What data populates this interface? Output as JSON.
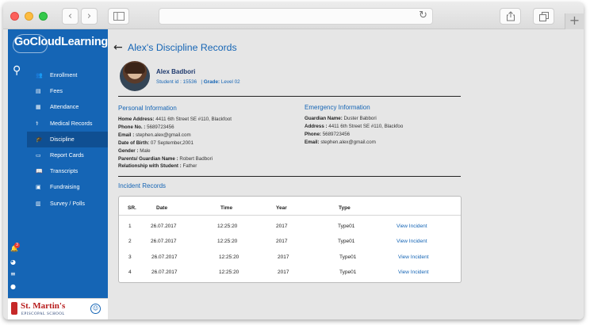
{
  "browser": {
    "back_glyph": "‹",
    "forward_glyph": "›",
    "reload_glyph": "↻"
  },
  "sidebar": {
    "logo": "GoCloudLearning",
    "items": [
      {
        "label": "Enrollment",
        "icon": "users-icon",
        "glyph": "👥"
      },
      {
        "label": "Fees",
        "icon": "fees-icon",
        "glyph": "▤"
      },
      {
        "label": "Attendance",
        "icon": "attendance-icon",
        "glyph": "▦"
      },
      {
        "label": "Medical Records",
        "icon": "stethoscope-icon",
        "glyph": "⚕"
      },
      {
        "label": "Discipline",
        "icon": "graduation-cap-icon",
        "glyph": "🎓"
      },
      {
        "label": "Report Cards",
        "icon": "report-card-icon",
        "glyph": "▭"
      },
      {
        "label": "Transcripts",
        "icon": "book-icon",
        "glyph": "📖"
      },
      {
        "label": "Fundraising",
        "icon": "fundraising-icon",
        "glyph": "▣"
      },
      {
        "label": "Survey / Polls",
        "icon": "survey-icon",
        "glyph": "▥"
      }
    ],
    "notification_count": "3",
    "school_name": "St. Martin's",
    "school_sub": "EPISCOPAL SCHOOL"
  },
  "page": {
    "title": "Alex's Discipline Records"
  },
  "student": {
    "name": "Alex Badbori",
    "id_label": "Student id :",
    "id_value": "15536",
    "grade_label": "Grade:",
    "grade_value": "Level 02"
  },
  "personal": {
    "title": "Personal Information",
    "fields": [
      {
        "label": "Home Address:",
        "value": "4411 6th Street SE #110, Blackfoot"
      },
      {
        "label": "Phone No. :",
        "value": "5689723456"
      },
      {
        "label": "Email :",
        "value": "stephen.alex@gmail.com"
      },
      {
        "label": "Date of Birth:",
        "value": "07 September,2001"
      },
      {
        "label": "Gender :",
        "value": "Male"
      },
      {
        "label": "Parents/ Guardian Name :",
        "value": "Robert Badbori"
      },
      {
        "label": "Relationship with Student :",
        "value": "Father"
      }
    ]
  },
  "emergency": {
    "title": "Emergency Information",
    "fields": [
      {
        "label": "Guardian Name:",
        "value": "Duster Babbori"
      },
      {
        "label": "Address :",
        "value": "4411 6th Street SE #110, Blackfoo"
      },
      {
        "label": "Phone:",
        "value": "5689723456"
      },
      {
        "label": "Email:",
        "value": "stephen.alex@gmail.com"
      }
    ]
  },
  "incidents": {
    "title": "Incident Records",
    "headers": [
      "SR.",
      "Date",
      "Time",
      "Year",
      "Type"
    ],
    "rows": [
      {
        "sr": "1",
        "date": "26.07.2017",
        "time": "12:25:20",
        "year": "2017",
        "type": "Type01",
        "action": "View Incident"
      },
      {
        "sr": "2",
        "date": "26.07.2017",
        "time": "12:25:20",
        "year": "2017",
        "type": "Type01",
        "action": "View Incident"
      },
      {
        "sr": "3",
        "date": "26.07.2017",
        "time": "12:25:20",
        "year": "2017",
        "type": "Type01",
        "action": "View Incident"
      },
      {
        "sr": "4",
        "date": "26.07.2017",
        "time": "12:25:20",
        "year": "2017",
        "type": "Type01",
        "action": "View Incident"
      }
    ]
  }
}
